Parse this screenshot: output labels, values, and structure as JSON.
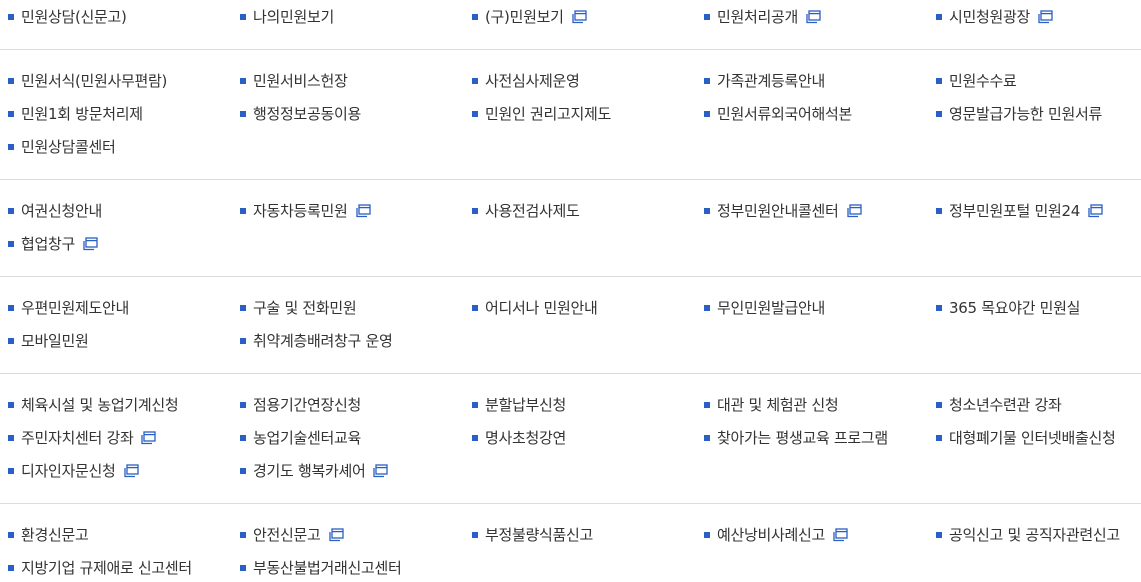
{
  "accent_color": "#2a5fc4",
  "divider_color": "#dcdcdc",
  "groups": [
    {
      "items": [
        {
          "label": "민원상담(신문고)",
          "external": false
        },
        {
          "label": "나의민원보기",
          "external": false
        },
        {
          "label": "(구)민원보기",
          "external": true
        },
        {
          "label": "민원처리공개",
          "external": true
        },
        {
          "label": "시민청원광장",
          "external": true
        }
      ]
    },
    {
      "items": [
        {
          "label": "민원서식(민원사무편람)",
          "external": false
        },
        {
          "label": "민원서비스헌장",
          "external": false
        },
        {
          "label": "사전심사제운영",
          "external": false
        },
        {
          "label": "가족관계등록안내",
          "external": false
        },
        {
          "label": "민원수수료",
          "external": false
        },
        {
          "label": "민원1회 방문처리제",
          "external": false
        },
        {
          "label": "행정정보공동이용",
          "external": false
        },
        {
          "label": "민원인 권리고지제도",
          "external": false
        },
        {
          "label": "민원서류외국어해석본",
          "external": false
        },
        {
          "label": "영문발급가능한 민원서류",
          "external": false
        },
        {
          "label": "민원상담콜센터",
          "external": false
        }
      ]
    },
    {
      "items": [
        {
          "label": "여권신청안내",
          "external": false
        },
        {
          "label": "자동차등록민원",
          "external": true
        },
        {
          "label": "사용전검사제도",
          "external": false
        },
        {
          "label": "정부민원안내콜센터",
          "external": true
        },
        {
          "label": "정부민원포털 민원24",
          "external": true
        },
        {
          "label": "협업창구",
          "external": true
        }
      ]
    },
    {
      "items": [
        {
          "label": "우편민원제도안내",
          "external": false
        },
        {
          "label": "구술 및 전화민원",
          "external": false
        },
        {
          "label": "어디서나 민원안내",
          "external": false
        },
        {
          "label": "무인민원발급안내",
          "external": false
        },
        {
          "label": "365 목요야간 민원실",
          "external": false
        },
        {
          "label": "모바일민원",
          "external": false
        },
        {
          "label": "취약계층배려창구 운영",
          "external": false
        }
      ]
    },
    {
      "items": [
        {
          "label": "체육시설 및 농업기계신청",
          "external": false
        },
        {
          "label": "점용기간연장신청",
          "external": false
        },
        {
          "label": "분할납부신청",
          "external": false
        },
        {
          "label": "대관 및 체험관 신청",
          "external": false
        },
        {
          "label": "청소년수련관 강좌",
          "external": false
        },
        {
          "label": "주민자치센터 강좌",
          "external": true
        },
        {
          "label": "농업기술센터교육",
          "external": false
        },
        {
          "label": "명사초청강연",
          "external": false
        },
        {
          "label": "찾아가는 평생교육 프로그램",
          "external": false
        },
        {
          "label": "대형폐기물 인터넷배출신청",
          "external": false
        },
        {
          "label": "디자인자문신청",
          "external": true
        },
        {
          "label": "경기도 행복카셰어",
          "external": true
        }
      ]
    },
    {
      "items": [
        {
          "label": "환경신문고",
          "external": false
        },
        {
          "label": "안전신문고",
          "external": true
        },
        {
          "label": "부정불량식품신고",
          "external": false
        },
        {
          "label": "예산낭비사례신고",
          "external": true
        },
        {
          "label": "공익신고 및 공직자관련신고",
          "external": false
        },
        {
          "label": "지방기업 규제애로 신고센터",
          "external": false
        },
        {
          "label": "부동산불법거래신고센터",
          "external": false
        }
      ]
    }
  ]
}
